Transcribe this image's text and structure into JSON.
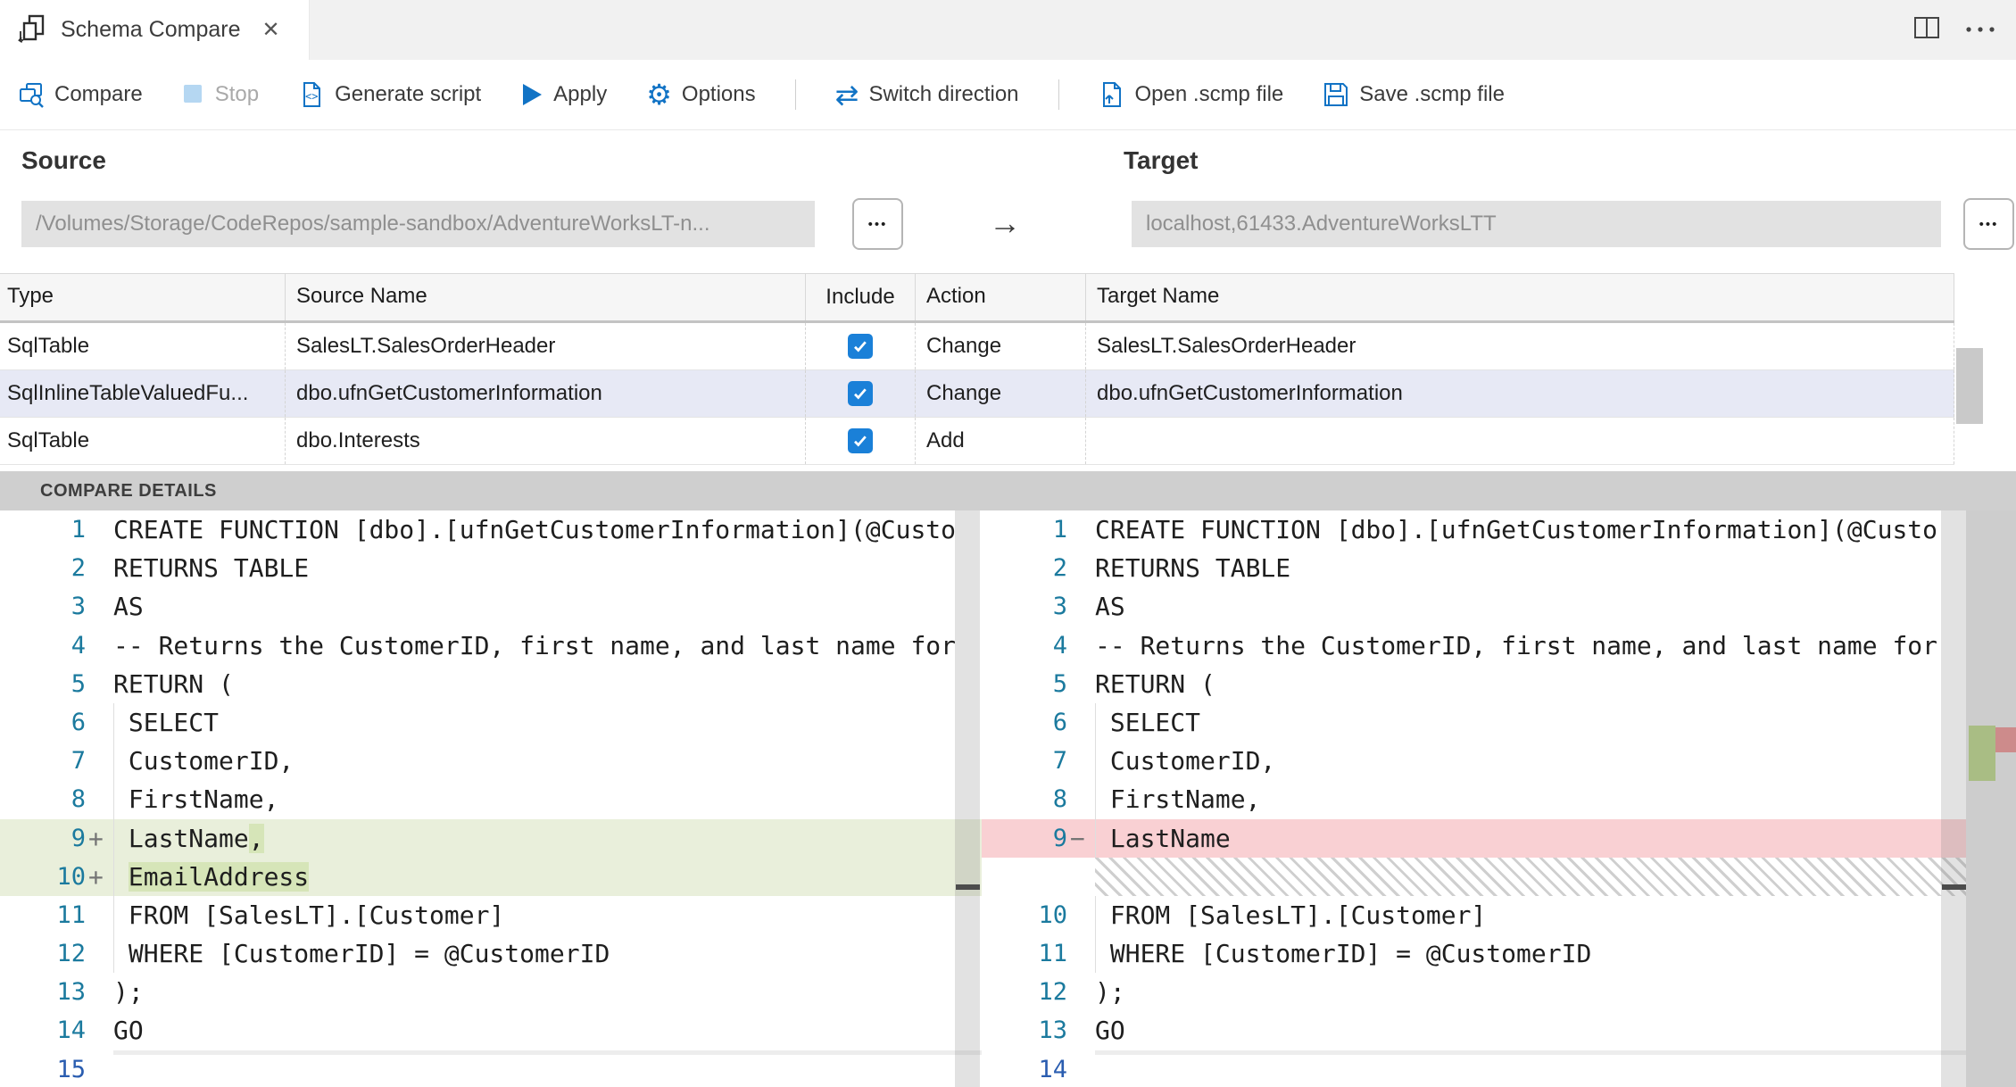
{
  "tab": {
    "title": "Schema Compare",
    "close_glyph": "✕"
  },
  "toolbar": {
    "items": [
      {
        "name": "compare",
        "label": "Compare",
        "icon": "compare-icon",
        "disabled": false
      },
      {
        "name": "stop",
        "label": "Stop",
        "icon": "stop-icon",
        "disabled": true
      },
      {
        "name": "generate-script",
        "label": "Generate script",
        "icon": "generate-script-icon",
        "disabled": false
      },
      {
        "name": "apply",
        "label": "Apply",
        "icon": "apply-icon",
        "disabled": false
      },
      {
        "name": "options",
        "label": "Options",
        "icon": "options-icon",
        "disabled": false
      },
      {
        "sep": true
      },
      {
        "name": "switch-direction",
        "label": "Switch direction",
        "icon": "switch-direction-icon",
        "disabled": false
      },
      {
        "sep": true
      },
      {
        "name": "open-scmp",
        "label": "Open .scmp file",
        "icon": "open-file-icon",
        "disabled": false
      },
      {
        "name": "save-scmp",
        "label": "Save .scmp file",
        "icon": "save-file-icon",
        "disabled": false
      }
    ]
  },
  "source": {
    "heading": "Source",
    "value": "/Volumes/Storage/CodeRepos/sample-sandbox/AdventureWorksLT-n...",
    "browse_label": "•••"
  },
  "target": {
    "heading": "Target",
    "value": "localhost,61433.AdventureWorksLTT",
    "browse_label": "•••"
  },
  "direction_arrow": "→",
  "grid": {
    "columns": [
      "Type",
      "Source Name",
      "Include",
      "Action",
      "Target Name"
    ],
    "rows": [
      {
        "type": "SqlTable",
        "source_name": "SalesLT.SalesOrderHeader",
        "include": true,
        "action": "Change",
        "target_name": "SalesLT.SalesOrderHeader",
        "selected": false
      },
      {
        "type": "SqlInlineTableValuedFu...",
        "source_name": "dbo.ufnGetCustomerInformation",
        "include": true,
        "action": "Change",
        "target_name": "dbo.ufnGetCustomerInformation",
        "selected": true
      },
      {
        "type": "SqlTable",
        "source_name": "dbo.Interests",
        "include": true,
        "action": "Add",
        "target_name": "",
        "selected": false
      }
    ]
  },
  "details": {
    "header": "COMPARE DETAILS"
  },
  "diff": {
    "left": {
      "lines": [
        {
          "n": 1,
          "text": "CREATE FUNCTION [dbo].[ufnGetCustomerInformation](@Custo"
        },
        {
          "n": 2,
          "text": "RETURNS TABLE"
        },
        {
          "n": 3,
          "text": "AS"
        },
        {
          "n": 4,
          "text": "-- Returns the CustomerID, first name, and last name for"
        },
        {
          "n": 5,
          "text": "RETURN ("
        },
        {
          "n": 6,
          "text": " SELECT",
          "guide": true
        },
        {
          "n": 7,
          "text": " CustomerID,",
          "guide": true
        },
        {
          "n": 8,
          "text": " FirstName,",
          "guide": true
        },
        {
          "n": 9,
          "kind": "insert",
          "sign": "+",
          "guide": true,
          "seg": {
            "pre": " LastName",
            "hl": ",",
            "post": ""
          }
        },
        {
          "n": 10,
          "kind": "insert",
          "sign": "+",
          "guide": true,
          "seg": {
            "pre": " ",
            "hl": "EmailAddress",
            "post": ""
          }
        },
        {
          "n": 11,
          "text": " FROM [SalesLT].[Customer]",
          "guide": true
        },
        {
          "n": 12,
          "text": " WHERE [CustomerID] = @CustomerID",
          "guide": true
        },
        {
          "n": 13,
          "text": ");"
        },
        {
          "n": 14,
          "text": "GO"
        },
        {
          "n": 15,
          "text": "",
          "current": true
        }
      ]
    },
    "right": {
      "lines": [
        {
          "n": 1,
          "text": "CREATE FUNCTION [dbo].[ufnGetCustomerInformation](@Custo"
        },
        {
          "n": 2,
          "text": "RETURNS TABLE"
        },
        {
          "n": 3,
          "text": "AS"
        },
        {
          "n": 4,
          "text": "-- Returns the CustomerID, first name, and last name for"
        },
        {
          "n": 5,
          "text": "RETURN ("
        },
        {
          "n": 6,
          "text": " SELECT",
          "guide": true
        },
        {
          "n": 7,
          "text": " CustomerID,",
          "guide": true
        },
        {
          "n": 8,
          "text": " FirstName,",
          "guide": true
        },
        {
          "n": 9,
          "text": " LastName",
          "kind": "delete",
          "sign": "−",
          "guide": true
        },
        {
          "kind": "spacer"
        },
        {
          "n": 10,
          "text": " FROM [SalesLT].[Customer]",
          "guide": true
        },
        {
          "n": 11,
          "text": " WHERE [CustomerID] = @CustomerID",
          "guide": true
        },
        {
          "n": 12,
          "text": ");"
        },
        {
          "n": 13,
          "text": "GO"
        },
        {
          "n": 14,
          "text": "",
          "current": true
        }
      ]
    }
  },
  "colors": {
    "accent": "#1173c5",
    "toolbar_text": "#3a3a3a",
    "disabled_text": "#a9a9a9",
    "heading_text": "#333333",
    "input_bg": "#e2e2e2",
    "input_text": "#8f8f8f",
    "selected_row_bg": "#e7e9f5",
    "checkbox_bg": "#1a80d8",
    "insert_line": "#e9efdb",
    "insert_char": "#d6e5b8",
    "delete_line": "#f9d0d3",
    "line_number": "#1b7a9e",
    "current_line_number": "#2a5db0",
    "ruler_green": "#a9bd84",
    "ruler_red": "#cd8b8b",
    "bar_bg": "#cfcfcf"
  }
}
